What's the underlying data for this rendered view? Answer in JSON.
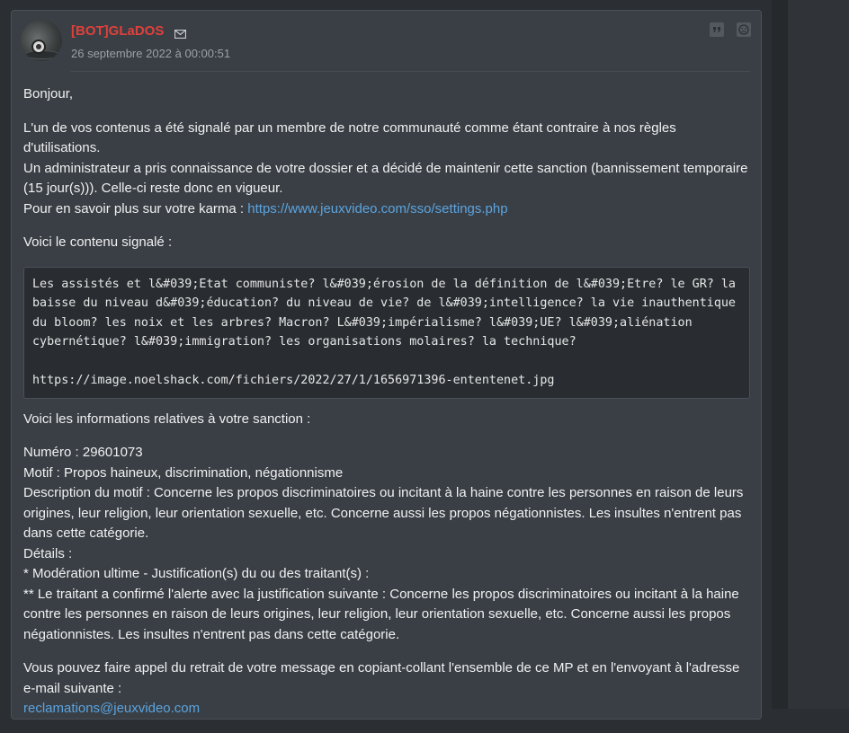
{
  "post": {
    "author": "[BOT]GLaDOS",
    "date": "26 septembre 2022 à 00:00:51"
  },
  "message": {
    "greeting": "Bonjour,",
    "intro_line1": "L'un de vos contenus a été signalé par un membre de notre communauté comme étant contraire à nos règles d'utilisations.",
    "intro_line2": "Un administrateur a pris connaissance de votre dossier et a décidé de maintenir cette sanction (bannissement temporaire (15 jour(s))). Celle-ci reste donc en vigueur.",
    "karma_text": "Pour en savoir plus sur votre karma : ",
    "karma_link": "https://www.jeuxvideo.com/sso/settings.php",
    "reported_intro": "Voici le contenu signalé :",
    "reported_content": "Les assistés et l&#039;Etat communiste? l&#039;érosion de la définition de l&#039;Etre? le GR? la baisse du niveau d&#039;éducation? du niveau de vie? de l&#039;intelligence? la vie inauthentique du bloom? les noix et les arbres? Macron? L&#039;impérialisme? l&#039;UE? l&#039;aliénation cybernétique? l&#039;immigration? les organisations molaires? la technique?\n\nhttps://image.noelshack.com/fichiers/2022/27/1/1656971396-ententenet.jpg",
    "sanction_intro": "Voici les informations relatives à votre sanction :",
    "numero": "Numéro : 29601073",
    "motif": "Motif : Propos haineux, discrimination, négationnisme",
    "description": "Description du motif : Concerne les propos discriminatoires ou incitant à la haine contre les personnes en raison de leurs origines, leur religion, leur orientation sexuelle, etc. Concerne aussi les propos négationnistes. Les insultes n'entrent pas dans cette catégorie.",
    "details": "Détails :",
    "moderation": "* Modération ultime - Justification(s) du ou des traitant(s) :",
    "justification": "** Le traitant a confirmé l'alerte avec la justification suivante : Concerne les propos discriminatoires ou incitant à la haine contre les personnes en raison de leurs origines, leur religion, leur orientation sexuelle, etc. Concerne aussi les propos négationnistes. Les insultes n'entrent pas dans cette catégorie.",
    "appeal": "Vous pouvez faire appel du retrait de votre message en copiant-collant l'ensemble de ce MP et en l'envoyant à l'adresse e-mail suivante :",
    "appeal_email": "reclamations@jeuxvideo.com"
  },
  "colors": {
    "author": "#e0403a",
    "link": "#5aa4e0",
    "background": "#3a3f45"
  },
  "icons": [
    "mail-icon",
    "quote-icon",
    "report-icon"
  ]
}
